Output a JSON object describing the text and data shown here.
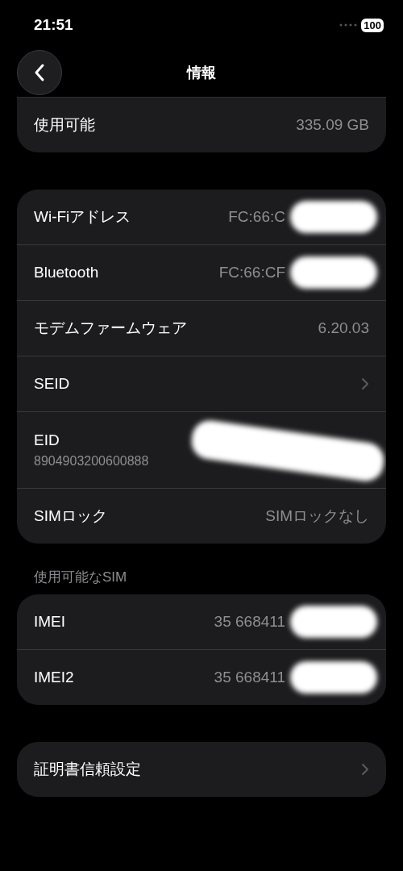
{
  "status_bar": {
    "time": "21:51",
    "battery": "100"
  },
  "nav": {
    "title": "情報"
  },
  "groups": [
    {
      "cut_top": true,
      "rows": [
        {
          "kind": "value",
          "label": "使用可能",
          "value": "335.09 GB"
        }
      ]
    },
    {
      "rows": [
        {
          "kind": "value",
          "label": "Wi-Fiアドレス",
          "value": "FC:66:C",
          "redacted": true
        },
        {
          "kind": "value",
          "label": "Bluetooth",
          "value": "FC:66:CF",
          "redacted": true
        },
        {
          "kind": "value",
          "label": "モデムファームウェア",
          "value": "6.20.03"
        },
        {
          "kind": "link",
          "label": "SEID"
        },
        {
          "kind": "stacked",
          "label": "EID",
          "value": "8904903200600888",
          "redacted": true
        },
        {
          "kind": "value",
          "label": "SIMロック",
          "value": "SIMロックなし"
        }
      ]
    },
    {
      "header": "使用可能なSIM",
      "rows": [
        {
          "kind": "value",
          "label": "IMEI",
          "value": "35 668411",
          "redacted": true
        },
        {
          "kind": "value",
          "label": "IMEI2",
          "value": "35 668411",
          "redacted": true
        }
      ]
    },
    {
      "rows": [
        {
          "kind": "link",
          "label": "証明書信頼設定"
        }
      ]
    }
  ]
}
